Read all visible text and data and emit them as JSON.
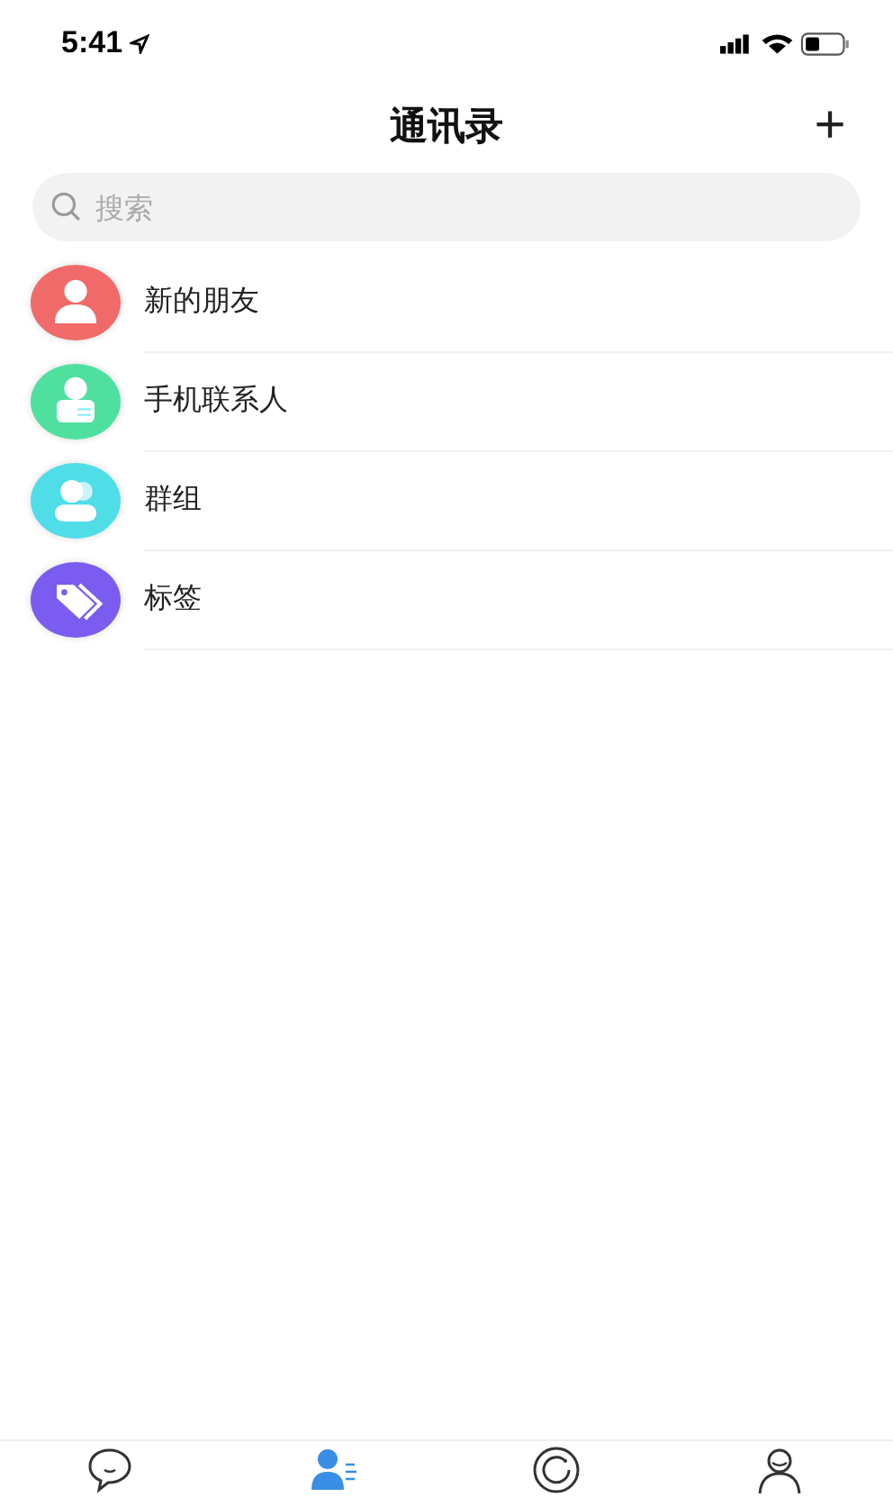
{
  "status_bar": {
    "time": "5:41"
  },
  "header": {
    "title": "通讯录",
    "add_button": "+"
  },
  "search": {
    "placeholder": "搜索"
  },
  "items": [
    {
      "kind": "person",
      "label": "新的朋友",
      "color": "#f06a6a"
    },
    {
      "kind": "contact",
      "label": "手机联系人",
      "color": "#4fe0a0"
    },
    {
      "kind": "group",
      "label": "群组",
      "color": "#4fdde8"
    },
    {
      "kind": "tag",
      "label": "标签",
      "color": "#7b5cf0"
    }
  ],
  "tabs": [
    {
      "kind": "chat",
      "selected": false
    },
    {
      "kind": "contacts",
      "selected": true
    },
    {
      "kind": "discover",
      "selected": false
    },
    {
      "kind": "me",
      "selected": false
    }
  ]
}
